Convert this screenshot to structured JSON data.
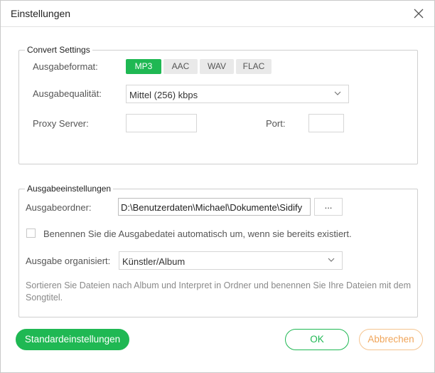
{
  "window": {
    "title": "Einstellungen",
    "close_icon": "close-icon"
  },
  "convert_settings": {
    "legend": "Convert Settings",
    "format_label": "Ausgabeformat:",
    "formats": [
      {
        "label": "MP3",
        "selected": true
      },
      {
        "label": "AAC",
        "selected": false
      },
      {
        "label": "WAV",
        "selected": false
      },
      {
        "label": "FLAC",
        "selected": false
      }
    ],
    "quality_label": "Ausgabequalität:",
    "quality_value": "Mittel (256) kbps",
    "proxy_label": "Proxy Server:",
    "proxy_value": "",
    "port_label": "Port:",
    "port_value": ""
  },
  "output_settings": {
    "legend": "Ausgabeeinstellungen",
    "folder_label": "Ausgabeordner:",
    "folder_value": "D:\\Benutzerdaten\\Michael\\Dokumente\\Sidify",
    "browse_label": "...",
    "rename_label": "Benennen Sie die Ausgabedatei automatisch um, wenn sie bereits existiert.",
    "rename_checked": false,
    "organize_label": "Ausgabe organisiert:",
    "organize_value": "Künstler/Album",
    "description": "Sortieren Sie Dateien nach Album und Interpret in Ordner und benennen Sie Ihre Dateien mit dem Songtitel."
  },
  "buttons": {
    "defaults": "Standardeinstellungen",
    "ok": "OK",
    "cancel": "Abbrechen"
  },
  "colors": {
    "accent": "#1fb853",
    "cancel": "#f0a55a"
  }
}
